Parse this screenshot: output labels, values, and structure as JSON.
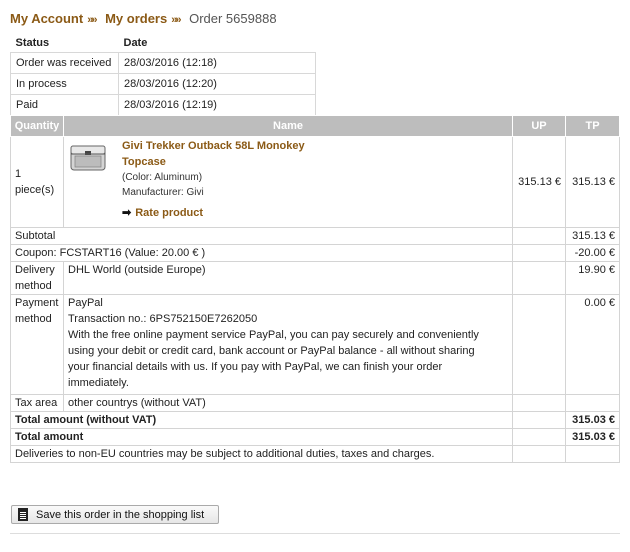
{
  "breadcrumb": {
    "account": "My Account",
    "orders": "My orders",
    "current": "Order 5659888",
    "sep": "»"
  },
  "status": {
    "headers": {
      "status": "Status",
      "date": "Date"
    },
    "rows": [
      {
        "status": "Order was received",
        "date": "28/03/2016 (12:18)"
      },
      {
        "status": "In process",
        "date": "28/03/2016 (12:20)"
      },
      {
        "status": "Paid",
        "date": "28/03/2016 (12:19)"
      }
    ]
  },
  "table": {
    "headers": {
      "quantity": "Quantity",
      "name": "Name",
      "up": "UP",
      "tp": "TP"
    },
    "product": {
      "quantity": "1 piece(s)",
      "name_line1": "Givi Trekker Outback 58L Monokey",
      "name_line2": "Topcase",
      "color": "(Color: Aluminum)",
      "manufacturer": "Manufacturer: Givi",
      "rate": "Rate product",
      "up": "315.13 €",
      "tp": "315.13 €"
    },
    "subtotal": {
      "label": "Subtotal",
      "value": "315.13 €"
    },
    "coupon": {
      "label": "Coupon: FCSTART16 (Value: 20.00 € )",
      "value": "-20.00 €"
    },
    "delivery": {
      "label_1": "Delivery",
      "label_2": "method",
      "value": "DHL World (outside Europe)",
      "price": "19.90 €"
    },
    "payment": {
      "label_1": "Payment",
      "label_2": "method",
      "name": "PayPal",
      "transaction": "Transaction no.: 6PS752150E7262050",
      "line1": "With the free online payment service PayPal, you can pay securely and conveniently",
      "line2": "using your debit or credit card, bank account or PayPal balance - all without sharing",
      "line3": "your financial details with us. If you pay with PayPal, we can finish your order",
      "line4": "immediately.",
      "price": "0.00 €"
    },
    "tax": {
      "label": "Tax area",
      "value": "other countrys (without VAT)"
    },
    "total_novat": {
      "label": "Total amount (without VAT)",
      "value": "315.03 €"
    },
    "total": {
      "label": "Total amount",
      "value": "315.03 €"
    },
    "note": "Deliveries to non-EU countries may be subject to additional duties, taxes and charges."
  },
  "save_button": "Save this order in the shopping list",
  "icons": {
    "breadcrumb_sep": "double-chevron-icon",
    "rate": "arrow-right-icon",
    "save": "document-icon",
    "product": "topcase-product-image"
  },
  "colors": {
    "link": "#8b5a16",
    "header_bg": "#bdbdbd"
  }
}
